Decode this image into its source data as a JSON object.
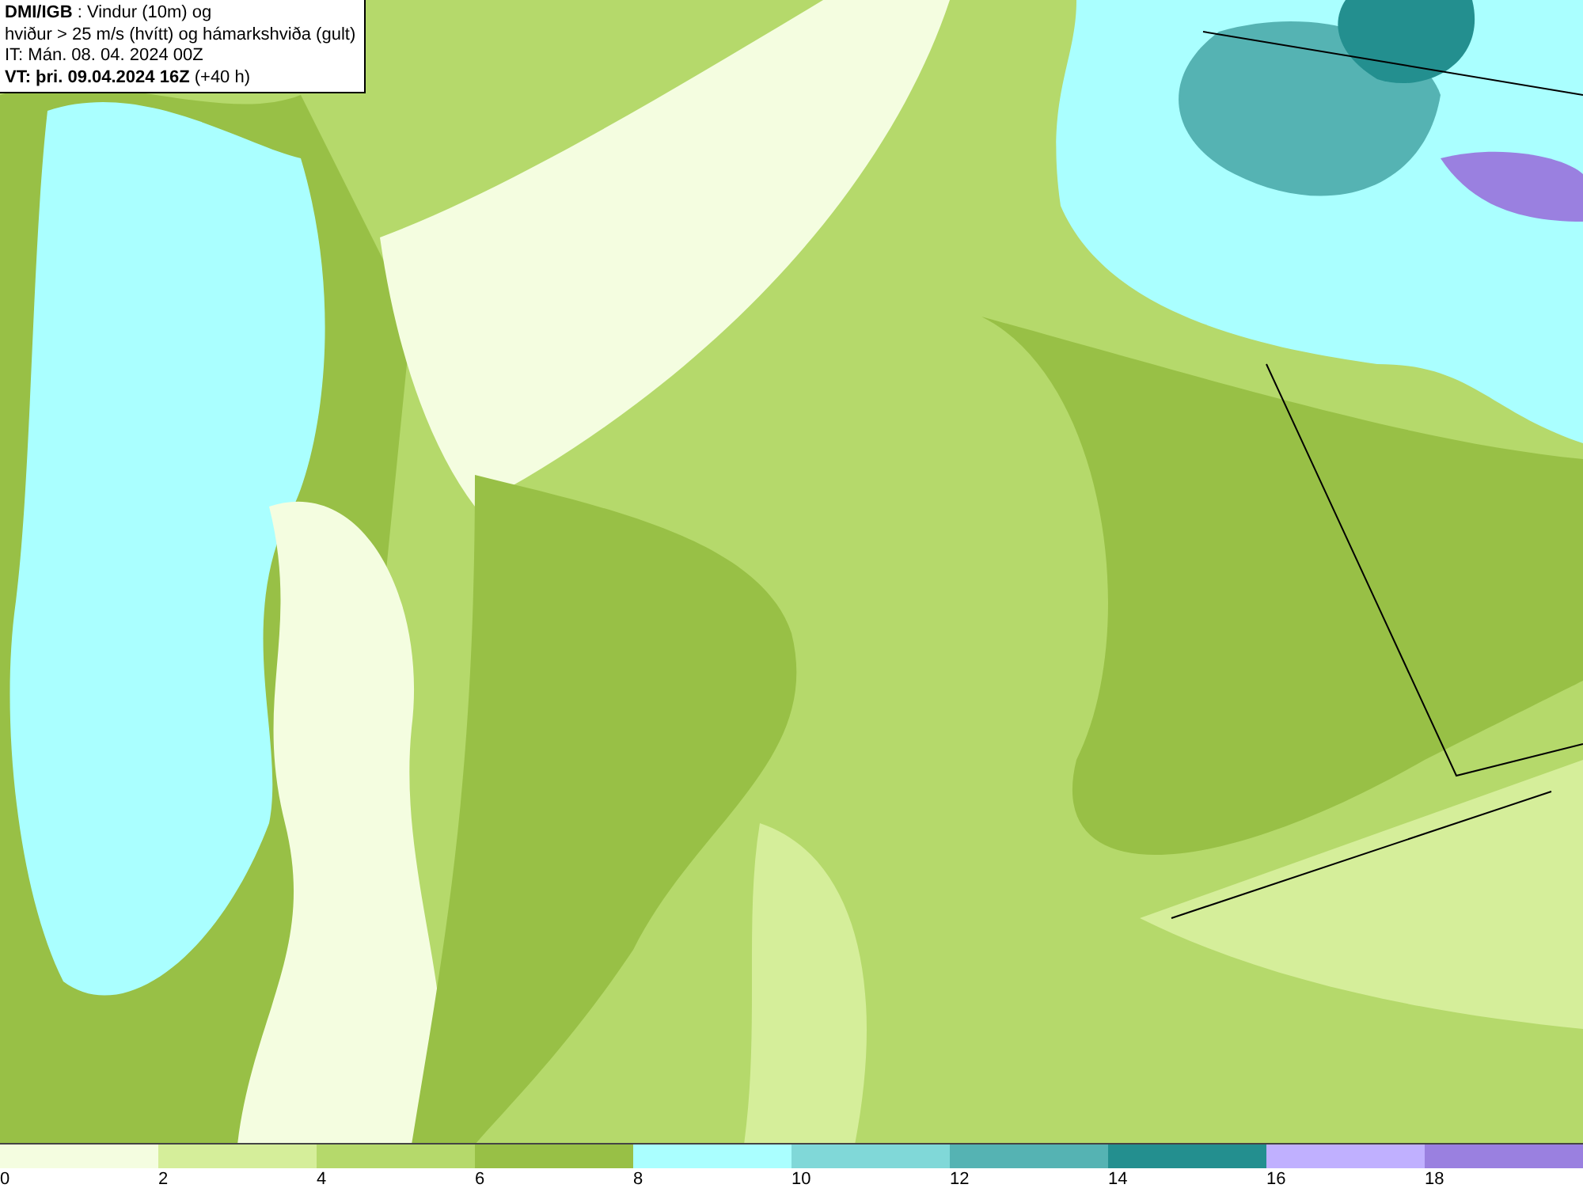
{
  "info_box": {
    "lines": [
      "**DMI/IGB** : Vindur (10m) og",
      "hviður > 25 m/s (hvítt) og hámarkshviða (gult)",
      "IT: Mán. 08. 04. 2024 00Z",
      "**VT: þri. 09.04.2024 16Z** (+40 h)"
    ]
  },
  "legend": [
    {
      "label": "0",
      "color": "#f4fde0"
    },
    {
      "label": "2",
      "color": "#d5ee9a"
    },
    {
      "label": "4",
      "color": "#b5d96b"
    },
    {
      "label": "6",
      "color": "#98c046"
    },
    {
      "label": "8",
      "color": "#aaffff"
    },
    {
      "label": "10",
      "color": "#80d8d8"
    },
    {
      "label": "12",
      "color": "#55b3b3"
    },
    {
      "label": "14",
      "color": "#238f8f"
    },
    {
      "label": "16",
      "color": "#c0b0ff"
    },
    {
      "label": "18",
      "color": "#9a80e0"
    }
  ]
}
